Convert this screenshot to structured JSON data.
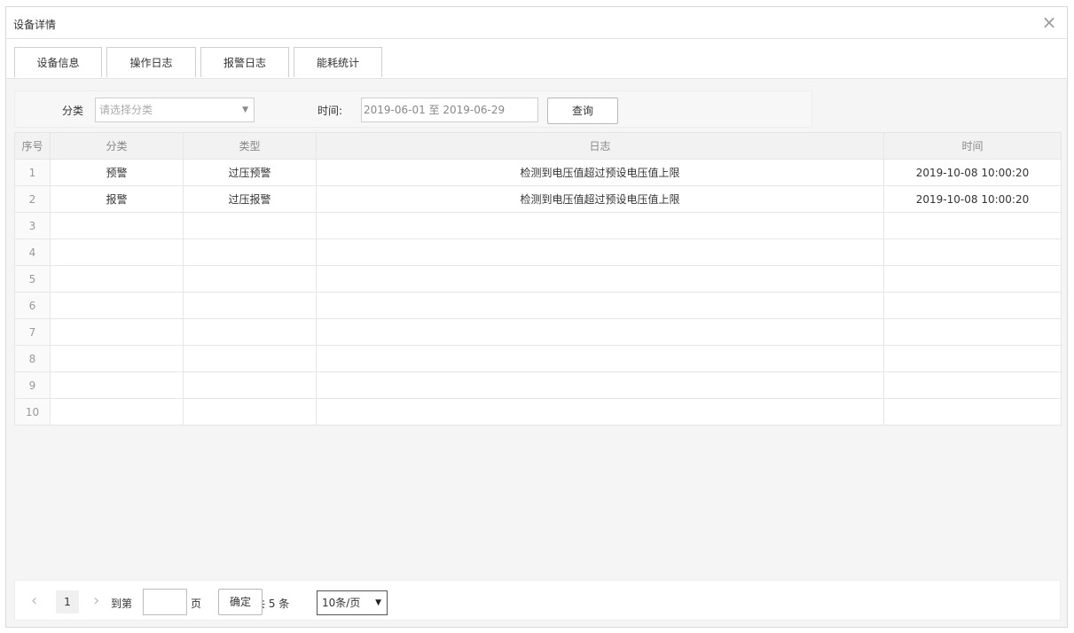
{
  "dialog": {
    "title": "设备详情",
    "close_icon": "×"
  },
  "tabs": [
    {
      "label": "设备信息"
    },
    {
      "label": "操作日志"
    },
    {
      "label": "报警日志"
    },
    {
      "label": "能耗统计"
    }
  ],
  "filter": {
    "category_label": "分类",
    "category_placeholder": "请选择分类",
    "time_label": "时间:",
    "date_range": "2019-06-01 至 2019-06-29",
    "query_button": "查询"
  },
  "table": {
    "headers": [
      "序号",
      "分类",
      "类型",
      "日志",
      "时间"
    ],
    "rows": [
      {
        "idx": "1",
        "category": "预警",
        "type": "过压预警",
        "log": "检测到电压值超过预设电压值上限",
        "time": "2019-10-08 10:00:20"
      },
      {
        "idx": "2",
        "category": "报警",
        "type": "过压报警",
        "log": "检测到电压值超过预设电压值上限",
        "time": "2019-10-08 10:00:20"
      },
      {
        "idx": "3",
        "category": "",
        "type": "",
        "log": "",
        "time": ""
      },
      {
        "idx": "4",
        "category": "",
        "type": "",
        "log": "",
        "time": ""
      },
      {
        "idx": "5",
        "category": "",
        "type": "",
        "log": "",
        "time": ""
      },
      {
        "idx": "6",
        "category": "",
        "type": "",
        "log": "",
        "time": ""
      },
      {
        "idx": "7",
        "category": "",
        "type": "",
        "log": "",
        "time": ""
      },
      {
        "idx": "8",
        "category": "",
        "type": "",
        "log": "",
        "time": ""
      },
      {
        "idx": "9",
        "category": "",
        "type": "",
        "log": "",
        "time": ""
      },
      {
        "idx": "10",
        "category": "",
        "type": "",
        "log": "",
        "time": ""
      }
    ]
  },
  "pager": {
    "prev_icon": "‹",
    "next_icon": "›",
    "current_page": "1",
    "goto_label": "到第",
    "page_suffix": "页",
    "confirm_button": "确定",
    "total_text": "共 5 条",
    "page_size": "10条/页"
  }
}
